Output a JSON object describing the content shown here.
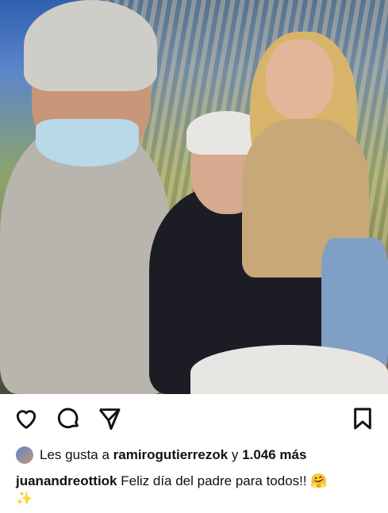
{
  "post": {
    "likes": {
      "prefix": "Les gusta a",
      "user": "ramirogutierrezok",
      "connector": "y",
      "count": "1.046 más"
    },
    "caption": {
      "username": "juanandreottiok",
      "text": "Feliz día del padre para todos!!",
      "emoji1": "🤗",
      "emoji2": "✨"
    },
    "icons": {
      "like": "heart-icon",
      "comment": "comment-icon",
      "share": "share-icon",
      "save": "bookmark-icon"
    }
  }
}
